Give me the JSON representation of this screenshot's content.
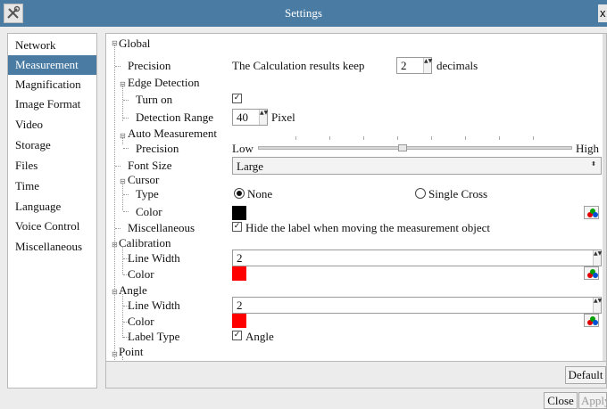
{
  "window": {
    "title": "Settings",
    "close_glyph": "x"
  },
  "sidebar": {
    "items": [
      {
        "label": "Network"
      },
      {
        "label": "Measurement",
        "active": true
      },
      {
        "label": "Magnification"
      },
      {
        "label": "Image Format"
      },
      {
        "label": "Video"
      },
      {
        "label": "Storage"
      },
      {
        "label": "Files"
      },
      {
        "label": "Time"
      },
      {
        "label": "Language"
      },
      {
        "label": "Voice Control"
      },
      {
        "label": "Miscellaneous"
      }
    ]
  },
  "global": {
    "label": "Global",
    "precision": {
      "label": "Precision",
      "prefix": "The Calculation results keep",
      "value": "2",
      "suffix": "decimals"
    },
    "edge_detection": {
      "label": "Edge Detection",
      "turn_on": {
        "label": "Turn on",
        "checked": true
      },
      "detection_range": {
        "label": "Detection Range",
        "value": "40",
        "unit": "Pixel"
      }
    },
    "auto_measurement": {
      "label": "Auto Measurement",
      "precision": {
        "label": "Precision",
        "low": "Low",
        "high": "High",
        "level": 0.46
      }
    },
    "font_size": {
      "label": "Font Size",
      "value": "Large"
    },
    "cursor": {
      "label": "Cursor",
      "type": {
        "label": "Type",
        "options": [
          "None",
          "Single Cross"
        ],
        "selected": "None"
      },
      "color": {
        "label": "Color",
        "value": "#000000"
      }
    },
    "miscellaneous": {
      "label": "Miscellaneous",
      "option": "Hide the label when moving the measurement object",
      "checked": true
    }
  },
  "calibration": {
    "label": "Calibration",
    "line_width": {
      "label": "Line Width",
      "value": "2"
    },
    "color": {
      "label": "Color",
      "value": "#ff0000"
    }
  },
  "angle": {
    "label": "Angle",
    "line_width": {
      "label": "Line Width",
      "value": "2"
    },
    "color": {
      "label": "Color",
      "value": "#ff0000"
    },
    "label_type": {
      "label": "Label Type",
      "option": "Angle",
      "checked": true
    }
  },
  "point": {
    "label": "Point"
  },
  "buttons": {
    "default": "Default",
    "close": "Close",
    "apply": "Apply"
  },
  "glyphs": {
    "expand": "⊟",
    "checkmark": "✓",
    "spin": "▲▼",
    "combo_arrow": "⬍"
  }
}
